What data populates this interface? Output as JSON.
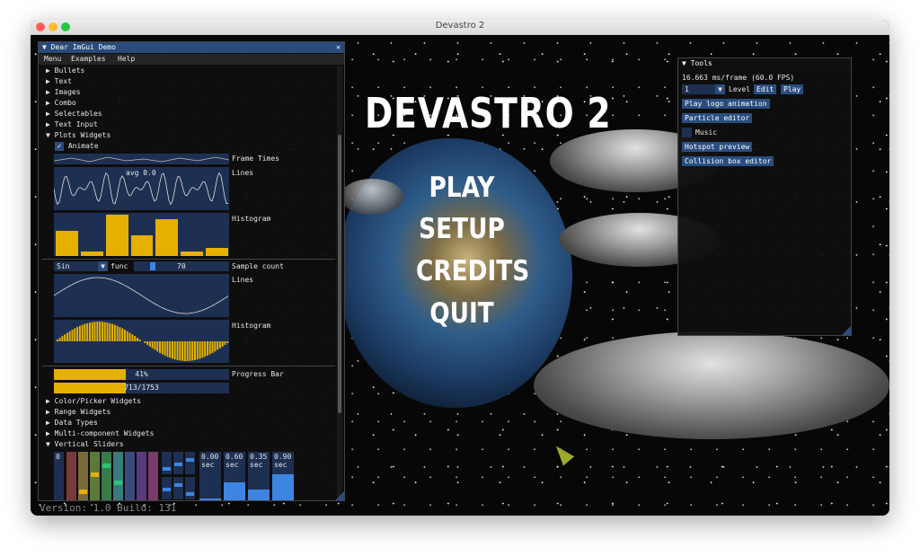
{
  "window": {
    "title": "Devastro 2"
  },
  "game": {
    "title": "DEVASTRO 2",
    "menu": [
      "PLAY",
      "SETUP",
      "CREDITS",
      "QUIT"
    ],
    "version": "Version: 1.0 Build: 131"
  },
  "demo": {
    "title": "Dear ImGui Demo",
    "menubar": [
      "Menu",
      "Examples",
      "Help"
    ],
    "sections_top": [
      "Bullets",
      "Text",
      "Images",
      "Combo",
      "Selectables",
      "Text Input"
    ],
    "plots_header": "Plots Widgets",
    "animate_label": "Animate",
    "frame_times_label": "Frame Times",
    "lines_label": "Lines",
    "lines_overlay": "avg 0.0",
    "histogram_label": "Histogram",
    "histogram_values": [
      0.6,
      0.1,
      1.0,
      0.5,
      0.9,
      0.1,
      0.2
    ],
    "func_combo": "Sin",
    "func_label": "func",
    "sample_count_value": "70",
    "sample_count_label": "Sample count",
    "lines2_label": "Lines",
    "histogram2_label": "Histogram",
    "progress_label": "Progress Bar",
    "progress1_text": "41%",
    "progress1_fraction": 0.41,
    "progress2_text": "713/1753",
    "progress2_fraction": 0.41,
    "sections_bottom": [
      "Color/Picker Widgets",
      "Range Widgets",
      "Data Types",
      "Multi-component Widgets"
    ],
    "vertical_sliders_header": "Vertical Sliders",
    "vslider_first_value": "0",
    "vslider_colors": [
      "#7a3a3a",
      "#7a6a3a",
      "#5a7a3a",
      "#3a7a4a",
      "#3a7a7a",
      "#3a4a7a",
      "#5a3a7a",
      "#7a3a6a"
    ],
    "vslider_values": [
      0.0,
      0.15,
      0.55,
      0.75,
      0.35,
      0.0,
      0.0,
      0.0
    ],
    "time_sliders": [
      {
        "value": "0.00",
        "unit": "sec",
        "fraction": 0.0
      },
      {
        "value": "0.60",
        "unit": "sec",
        "fraction": 0.6
      },
      {
        "value": "0.35",
        "unit": "sec",
        "fraction": 0.35
      },
      {
        "value": "0.90",
        "unit": "sec",
        "fraction": 0.9
      }
    ]
  },
  "tools": {
    "title": "Tools",
    "fps_text": "16.663 ms/frame (60.0 FPS)",
    "level_combo": "1",
    "level_label": "Level",
    "edit_button": "Edit",
    "play_button": "Play",
    "buttons": [
      "Play logo animation",
      "Particle editor"
    ],
    "music_label": "Music",
    "buttons2": [
      "Hotspot preview",
      "Collision box editor"
    ]
  },
  "colors": {
    "accent": "#2a4d7f",
    "plot": "#e6b000",
    "title_active": "#294a7a"
  }
}
